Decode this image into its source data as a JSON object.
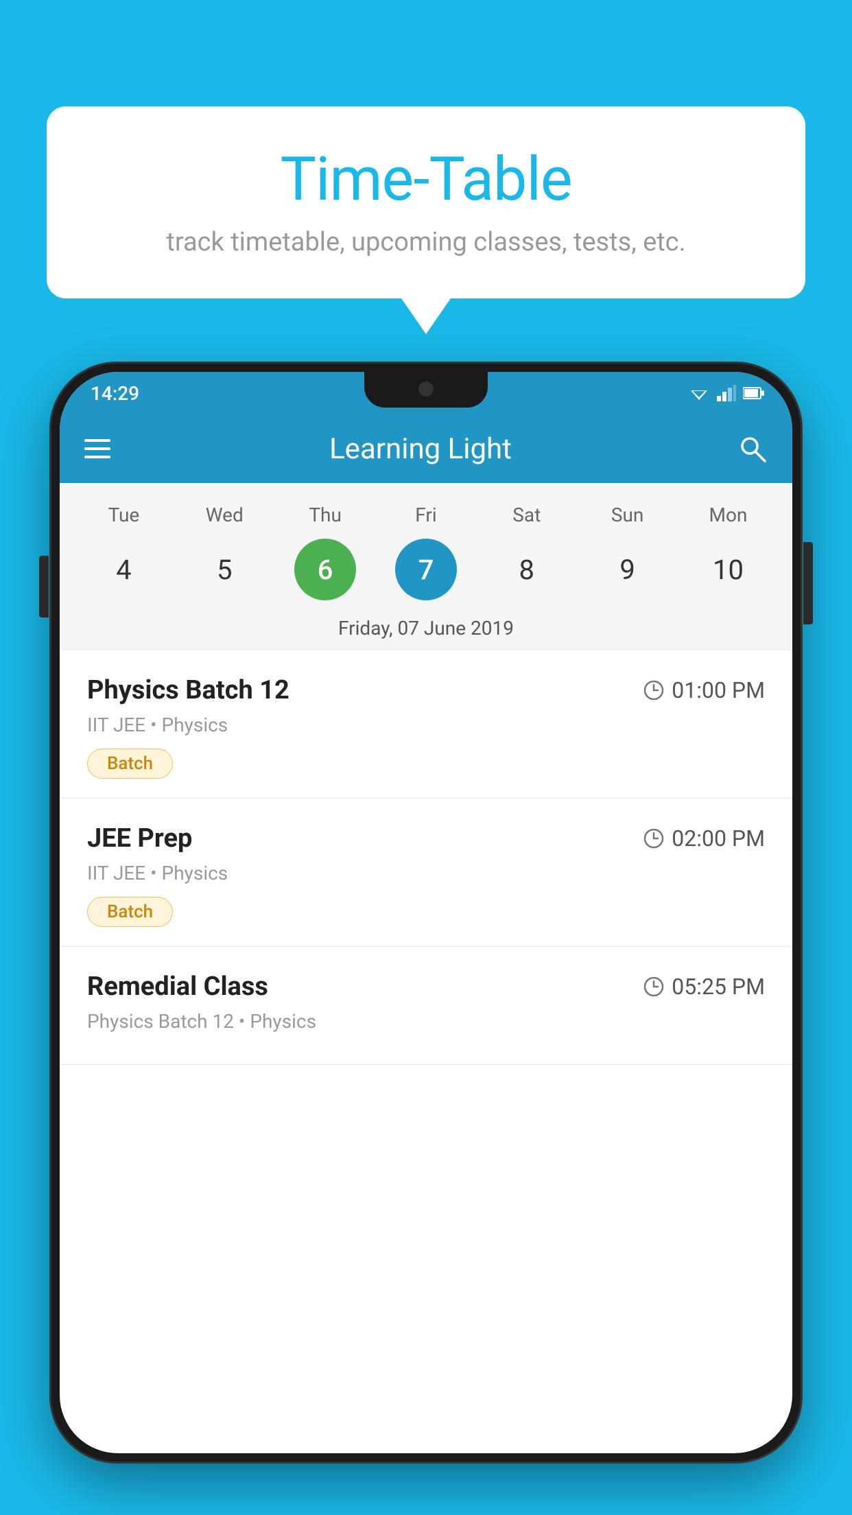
{
  "background_color": "#1ab8e8",
  "speech_bubble": {
    "title": "Time-Table",
    "subtitle": "track timetable, upcoming classes, tests, etc."
  },
  "phone": {
    "status_bar": {
      "time": "14:29"
    },
    "toolbar": {
      "title": "Learning Light"
    },
    "calendar": {
      "days": [
        "Tue",
        "Wed",
        "Thu",
        "Fri",
        "Sat",
        "Sun",
        "Mon"
      ],
      "dates": [
        "4",
        "5",
        "6",
        "7",
        "8",
        "9",
        "10"
      ],
      "today_index": 2,
      "selected_index": 3,
      "selected_label": "Friday, 07 June 2019"
    },
    "schedule_items": [
      {
        "title": "Physics Batch 12",
        "time": "01:00 PM",
        "subtitle": "IIT JEE • Physics",
        "badge": "Batch"
      },
      {
        "title": "JEE Prep",
        "time": "02:00 PM",
        "subtitle": "IIT JEE • Physics",
        "badge": "Batch"
      },
      {
        "title": "Remedial Class",
        "time": "05:25 PM",
        "subtitle": "Physics Batch 12 • Physics",
        "badge": null
      }
    ]
  }
}
